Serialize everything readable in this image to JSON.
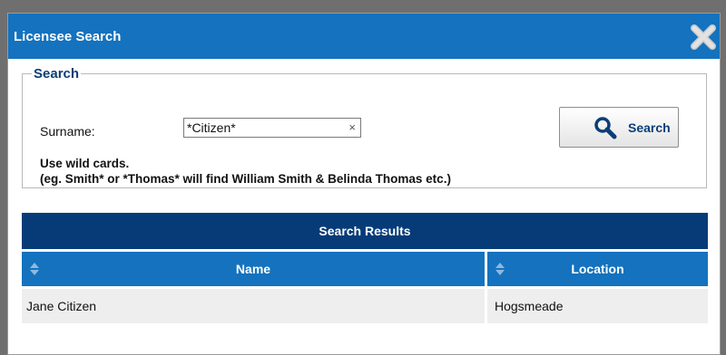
{
  "dialog": {
    "title": "Licensee Search",
    "close_icon": "close-x-icon"
  },
  "search": {
    "legend": "Search",
    "surname_label": "Surname:",
    "surname_value": "*Citizen*",
    "clear_glyph": "×",
    "hint_line1": "Use wild cards.",
    "hint_line2": "(eg. Smith* or *Thomas* will find William Smith & Belinda Thomas etc.)",
    "button_label": "Search",
    "button_icon": "magnifier-icon"
  },
  "results": {
    "header": "Search Results",
    "columns": [
      "Name",
      "Location"
    ],
    "rows": [
      {
        "name": "Jane Citizen",
        "location": "Hogsmeade"
      }
    ]
  },
  "colors": {
    "titlebar": "#1472be",
    "results_header": "#063b78",
    "column_header": "#1472be",
    "row_bg": "#eeeeee"
  }
}
